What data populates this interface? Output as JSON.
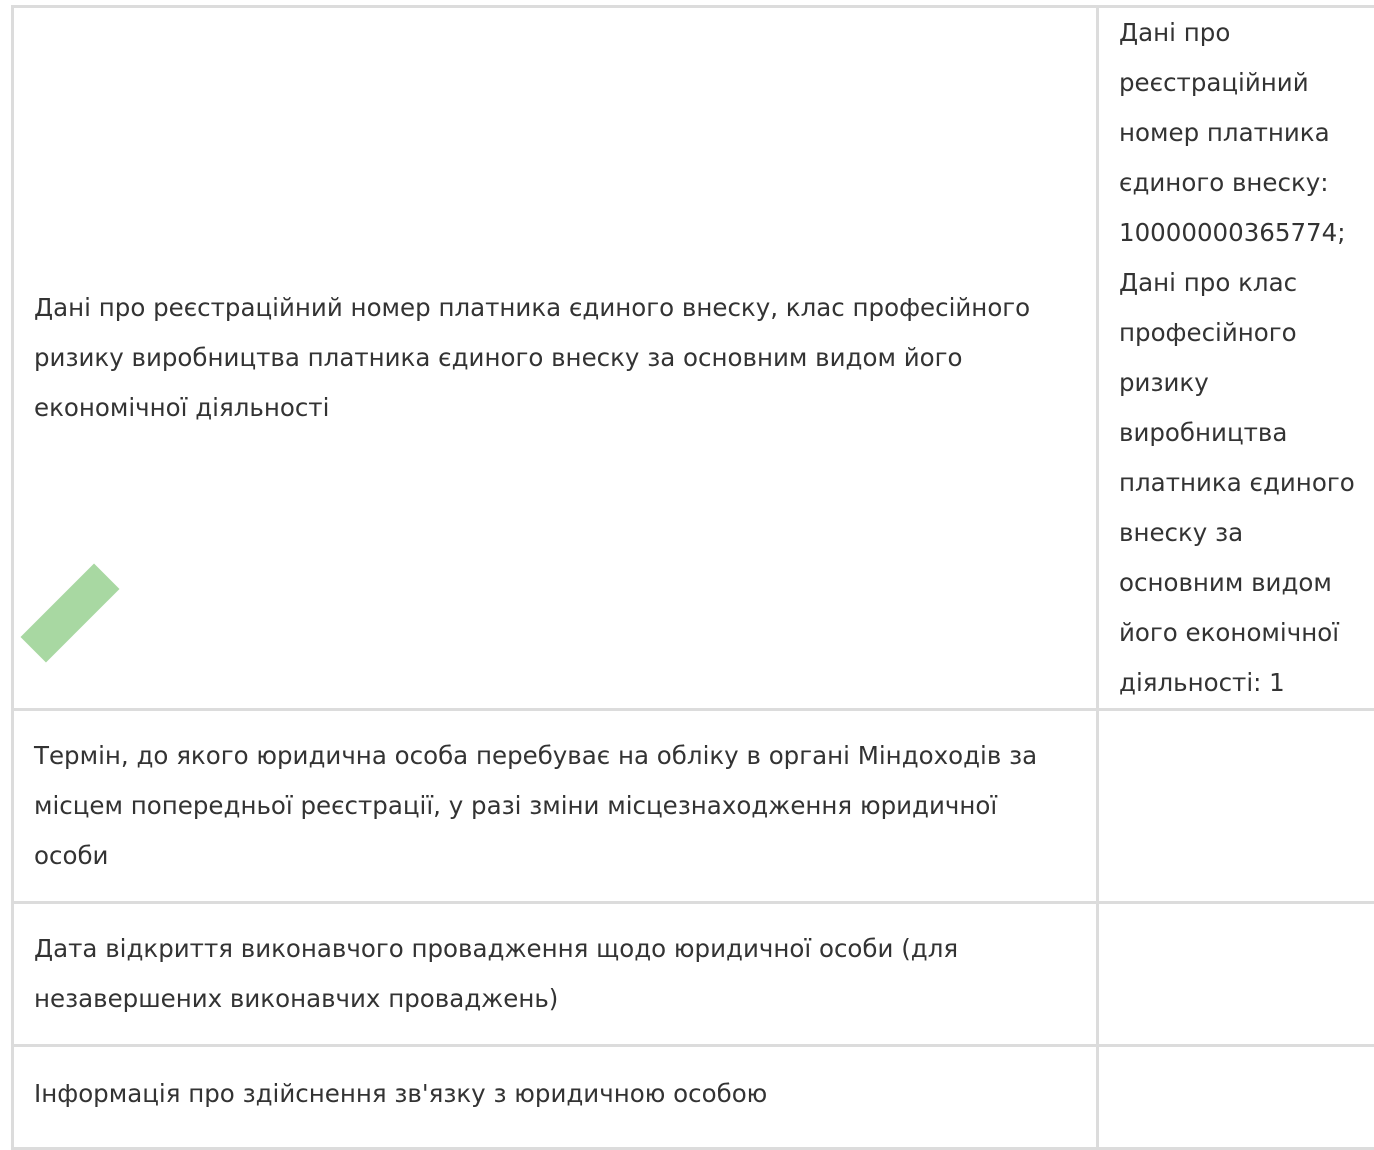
{
  "rows": [
    {
      "label": "Дані про реєстраційний номер платника єдиного внеску, клас професійного ризику виробництва платника єдиного внеску за основним видом його економічної діяльності",
      "value": "Дані про реєстраційний номер платника єдиного внеску: 10000000365774; Дані про клас професійного ризику виробництва платника єдиного внеску за основним видом його економічної діяльності: 1"
    },
    {
      "label": "Термін, до якого юридична особа перебуває на обліку в органі Міндоходів за місцем попередньої реєстрації, у разі зміни місцезнаходження юридичної особи",
      "value": ""
    },
    {
      "label": "Дата відкриття виконавчого провадження щодо юридичної особи (для незавершених виконавчих проваджень)",
      "value": ""
    },
    {
      "label": "Інформація про здійснення зв'язку з юридичною особою",
      "value": ""
    }
  ]
}
